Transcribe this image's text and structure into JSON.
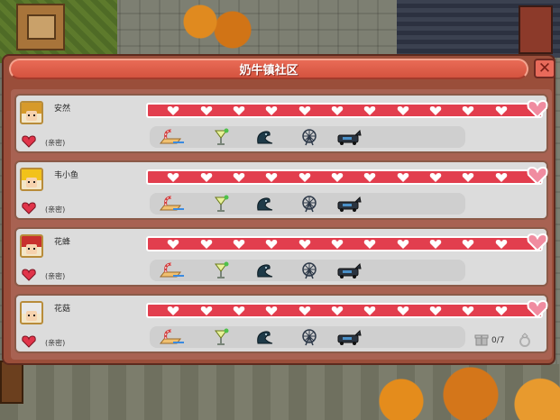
{
  "window": {
    "title": "奶牛镇社区",
    "close_label": "✕"
  },
  "colors": {
    "bar_red": "#e23e4e",
    "heart_white": "#ffffff",
    "big_heart_pink": "#f08ca0",
    "status_heart": "#e0344a"
  },
  "icons": {
    "gifts": [
      "beach-chair-icon",
      "cocktail-glass-icon",
      "seal-icon",
      "ferris-wheel-icon",
      "motorcycle-icon"
    ],
    "close": "close-icon",
    "status": "heart-icon",
    "gift_box": "gift-box-icon",
    "ring": "wedding-ring-icon"
  },
  "characters": [
    {
      "name": "安然",
      "status": "(亲密)",
      "hearts_filled": 12,
      "hearts_total": 12,
      "hair_color": "#d79a2a",
      "avatar_icon": "blonde-girl-avatar"
    },
    {
      "name": "韦小鱼",
      "status": "(亲密)",
      "hearts_filled": 12,
      "hearts_total": 12,
      "hair_color": "#f2c21a",
      "avatar_icon": "blonde-boy-avatar"
    },
    {
      "name": "花蜂",
      "status": "(亲密)",
      "hearts_filled": 12,
      "hearts_total": 12,
      "hair_color": "#c8302e",
      "avatar_icon": "red-hair-avatar"
    },
    {
      "name": "花菇",
      "status": "(亲密)",
      "hearts_filled": 12,
      "hearts_total": 12,
      "hair_color": "#e8e8e8",
      "avatar_icon": "white-hat-avatar",
      "gift_progress": "0/7"
    }
  ]
}
